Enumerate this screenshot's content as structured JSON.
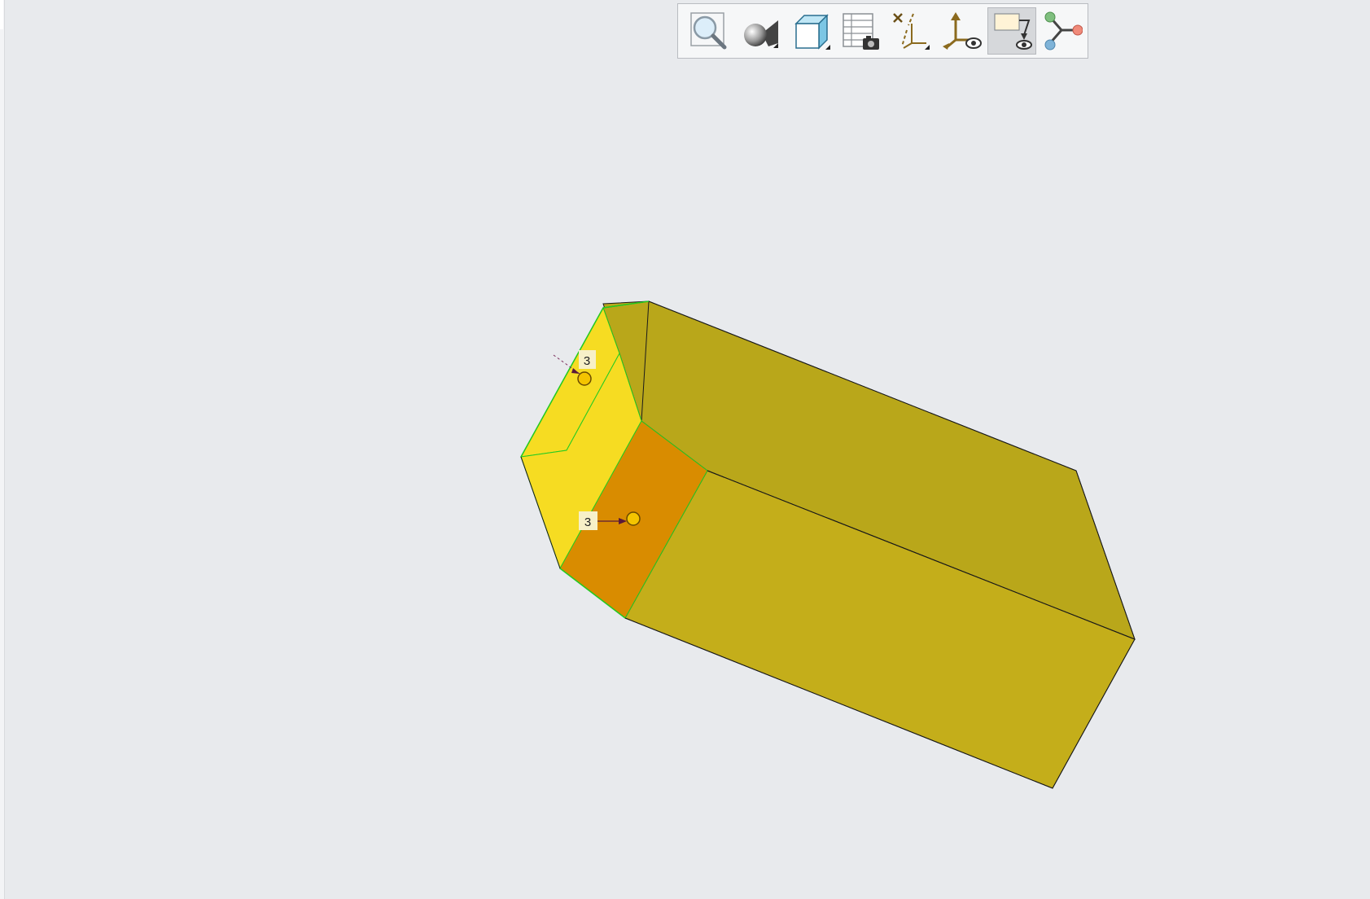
{
  "toolbar": {
    "tools": [
      {
        "name": "zoom-view-icon",
        "active": false
      },
      {
        "name": "appearance-gallery-icon",
        "active": false
      },
      {
        "name": "display-style-icon",
        "active": false
      },
      {
        "name": "view-manager-icon",
        "active": false
      },
      {
        "name": "datum-display-icon",
        "active": false
      },
      {
        "name": "csys-display-icon",
        "active": false
      },
      {
        "name": "annotation-display-icon",
        "active": true
      },
      {
        "name": "spin-center-icon",
        "active": false
      }
    ]
  },
  "model": {
    "colors": {
      "top_face": "#b9a71a",
      "front_face": "#c4ae1a",
      "end_face": "#f6dc22",
      "highlight_face": "#d98c00",
      "selected_edge": "#22cc22"
    }
  },
  "annotations": {
    "callout_top": {
      "label": "3"
    },
    "callout_bottom": {
      "label": "3"
    }
  }
}
